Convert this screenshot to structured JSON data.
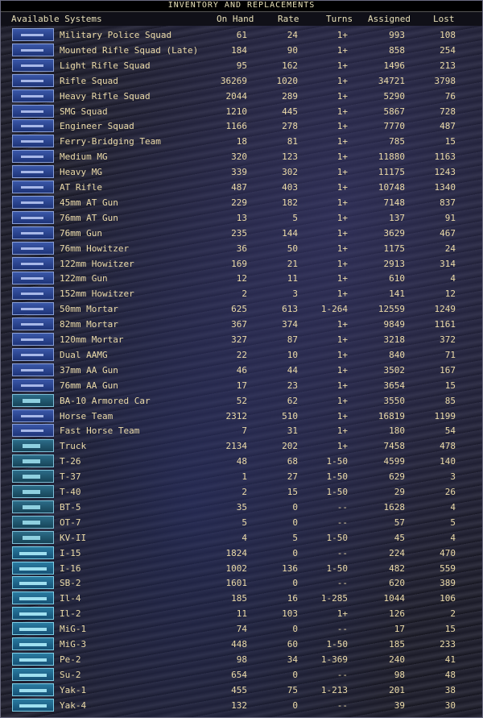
{
  "title": "INVENTORY AND REPLACEMENTS",
  "columns": {
    "name": "Available Systems",
    "on_hand": "On Hand",
    "rate": "Rate",
    "turns": "Turns",
    "assigned": "Assigned",
    "lost": "Lost"
  },
  "rows": [
    {
      "name": "Military Police Squad",
      "on_hand": "61",
      "rate": "24",
      "turns": "1+",
      "assigned": "993",
      "lost": "108",
      "icon": "rifle-icon"
    },
    {
      "name": "Mounted Rifle Squad (Late)",
      "on_hand": "184",
      "rate": "90",
      "turns": "1+",
      "assigned": "858",
      "lost": "254",
      "icon": "rifle-icon"
    },
    {
      "name": "Light Rifle Squad",
      "on_hand": "95",
      "rate": "162",
      "turns": "1+",
      "assigned": "1496",
      "lost": "213",
      "icon": "rifle-icon"
    },
    {
      "name": "Rifle Squad",
      "on_hand": "36269",
      "rate": "1020",
      "turns": "1+",
      "assigned": "34721",
      "lost": "3798",
      "icon": "rifle-icon"
    },
    {
      "name": "Heavy Rifle Squad",
      "on_hand": "2044",
      "rate": "289",
      "turns": "1+",
      "assigned": "5290",
      "lost": "76",
      "icon": "rifle-icon"
    },
    {
      "name": "SMG Squad",
      "on_hand": "1210",
      "rate": "445",
      "turns": "1+",
      "assigned": "5867",
      "lost": "728",
      "icon": "smg-icon"
    },
    {
      "name": "Engineer Squad",
      "on_hand": "1166",
      "rate": "278",
      "turns": "1+",
      "assigned": "7770",
      "lost": "487",
      "icon": "rifle-icon"
    },
    {
      "name": "Ferry-Bridging Team",
      "on_hand": "18",
      "rate": "81",
      "turns": "1+",
      "assigned": "785",
      "lost": "15",
      "icon": "rifle-icon"
    },
    {
      "name": "Medium MG",
      "on_hand": "320",
      "rate": "123",
      "turns": "1+",
      "assigned": "11880",
      "lost": "1163",
      "icon": "machine-gun-icon"
    },
    {
      "name": "Heavy MG",
      "on_hand": "339",
      "rate": "302",
      "turns": "1+",
      "assigned": "11175",
      "lost": "1243",
      "icon": "machine-gun-icon"
    },
    {
      "name": "AT Rifle",
      "on_hand": "487",
      "rate": "403",
      "turns": "1+",
      "assigned": "10748",
      "lost": "1340",
      "icon": "rifle-icon"
    },
    {
      "name": "45mm AT Gun",
      "on_hand": "229",
      "rate": "182",
      "turns": "1+",
      "assigned": "7148",
      "lost": "837",
      "icon": "gun-icon"
    },
    {
      "name": "76mm AT Gun",
      "on_hand": "13",
      "rate": "5",
      "turns": "1+",
      "assigned": "137",
      "lost": "91",
      "icon": "gun-icon"
    },
    {
      "name": "76mm Gun",
      "on_hand": "235",
      "rate": "144",
      "turns": "1+",
      "assigned": "3629",
      "lost": "467",
      "icon": "gun-icon"
    },
    {
      "name": "76mm Howitzer",
      "on_hand": "36",
      "rate": "50",
      "turns": "1+",
      "assigned": "1175",
      "lost": "24",
      "icon": "gun-icon"
    },
    {
      "name": "122mm Howitzer",
      "on_hand": "169",
      "rate": "21",
      "turns": "1+",
      "assigned": "2913",
      "lost": "314",
      "icon": "gun-icon"
    },
    {
      "name": "122mm Gun",
      "on_hand": "12",
      "rate": "11",
      "turns": "1+",
      "assigned": "610",
      "lost": "4",
      "icon": "gun-icon"
    },
    {
      "name": "152mm Howitzer",
      "on_hand": "2",
      "rate": "3",
      "turns": "1+",
      "assigned": "141",
      "lost": "12",
      "icon": "gun-icon"
    },
    {
      "name": "50mm Mortar",
      "on_hand": "625",
      "rate": "613",
      "turns": "1-264",
      "assigned": "12559",
      "lost": "1249",
      "icon": "mortar-icon"
    },
    {
      "name": "82mm Mortar",
      "on_hand": "367",
      "rate": "374",
      "turns": "1+",
      "assigned": "9849",
      "lost": "1161",
      "icon": "mortar-icon"
    },
    {
      "name": "120mm Mortar",
      "on_hand": "327",
      "rate": "87",
      "turns": "1+",
      "assigned": "3218",
      "lost": "372",
      "icon": "mortar-icon"
    },
    {
      "name": "Dual AAMG",
      "on_hand": "22",
      "rate": "10",
      "turns": "1+",
      "assigned": "840",
      "lost": "71",
      "icon": "aa-gun-icon"
    },
    {
      "name": "37mm AA Gun",
      "on_hand": "46",
      "rate": "44",
      "turns": "1+",
      "assigned": "3502",
      "lost": "167",
      "icon": "aa-gun-icon"
    },
    {
      "name": "76mm AA Gun",
      "on_hand": "17",
      "rate": "23",
      "turns": "1+",
      "assigned": "3654",
      "lost": "15",
      "icon": "aa-gun-icon"
    },
    {
      "name": "BA-10 Armored Car",
      "on_hand": "52",
      "rate": "62",
      "turns": "1+",
      "assigned": "3550",
      "lost": "85",
      "icon": "armored-car-icon"
    },
    {
      "name": "Horse Team",
      "on_hand": "2312",
      "rate": "510",
      "turns": "1+",
      "assigned": "16819",
      "lost": "1199",
      "icon": "horse-icon"
    },
    {
      "name": "Fast Horse Team",
      "on_hand": "7",
      "rate": "31",
      "turns": "1+",
      "assigned": "180",
      "lost": "54",
      "icon": "horse-icon"
    },
    {
      "name": "Truck",
      "on_hand": "2134",
      "rate": "202",
      "turns": "1+",
      "assigned": "7458",
      "lost": "478",
      "icon": "truck-icon"
    },
    {
      "name": "T-26",
      "on_hand": "48",
      "rate": "68",
      "turns": "1-50",
      "assigned": "4599",
      "lost": "140",
      "icon": "tank-icon"
    },
    {
      "name": "T-37",
      "on_hand": "1",
      "rate": "27",
      "turns": "1-50",
      "assigned": "629",
      "lost": "3",
      "icon": "tank-icon"
    },
    {
      "name": "T-40",
      "on_hand": "2",
      "rate": "15",
      "turns": "1-50",
      "assigned": "29",
      "lost": "26",
      "icon": "tank-icon"
    },
    {
      "name": "BT-5",
      "on_hand": "35",
      "rate": "0",
      "turns": "--",
      "assigned": "1628",
      "lost": "4",
      "icon": "tank-icon"
    },
    {
      "name": "OT-7",
      "on_hand": "5",
      "rate": "0",
      "turns": "--",
      "assigned": "57",
      "lost": "5",
      "icon": "tank-icon"
    },
    {
      "name": "KV-II",
      "on_hand": "4",
      "rate": "5",
      "turns": "1-50",
      "assigned": "45",
      "lost": "4",
      "icon": "tank-icon"
    },
    {
      "name": "I-15",
      "on_hand": "1824",
      "rate": "0",
      "turns": "--",
      "assigned": "224",
      "lost": "470",
      "icon": "aircraft-icon"
    },
    {
      "name": "I-16",
      "on_hand": "1002",
      "rate": "136",
      "turns": "1-50",
      "assigned": "482",
      "lost": "559",
      "icon": "aircraft-icon"
    },
    {
      "name": "SB-2",
      "on_hand": "1601",
      "rate": "0",
      "turns": "--",
      "assigned": "620",
      "lost": "389",
      "icon": "aircraft-icon"
    },
    {
      "name": "Il-4",
      "on_hand": "185",
      "rate": "16",
      "turns": "1-285",
      "assigned": "1044",
      "lost": "106",
      "icon": "aircraft-icon"
    },
    {
      "name": "Il-2",
      "on_hand": "11",
      "rate": "103",
      "turns": "1+",
      "assigned": "126",
      "lost": "2",
      "icon": "aircraft-icon"
    },
    {
      "name": "MiG-1",
      "on_hand": "74",
      "rate": "0",
      "turns": "--",
      "assigned": "17",
      "lost": "15",
      "icon": "aircraft-icon"
    },
    {
      "name": "MiG-3",
      "on_hand": "448",
      "rate": "60",
      "turns": "1-50",
      "assigned": "185",
      "lost": "233",
      "icon": "aircraft-icon"
    },
    {
      "name": "Pe-2",
      "on_hand": "98",
      "rate": "34",
      "turns": "1-369",
      "assigned": "240",
      "lost": "41",
      "icon": "aircraft-icon"
    },
    {
      "name": "Su-2",
      "on_hand": "654",
      "rate": "0",
      "turns": "--",
      "assigned": "98",
      "lost": "48",
      "icon": "aircraft-icon"
    },
    {
      "name": "Yak-1",
      "on_hand": "455",
      "rate": "75",
      "turns": "1-213",
      "assigned": "201",
      "lost": "38",
      "icon": "aircraft-icon"
    },
    {
      "name": "Yak-4",
      "on_hand": "132",
      "rate": "0",
      "turns": "--",
      "assigned": "39",
      "lost": "30",
      "icon": "aircraft-icon"
    }
  ]
}
